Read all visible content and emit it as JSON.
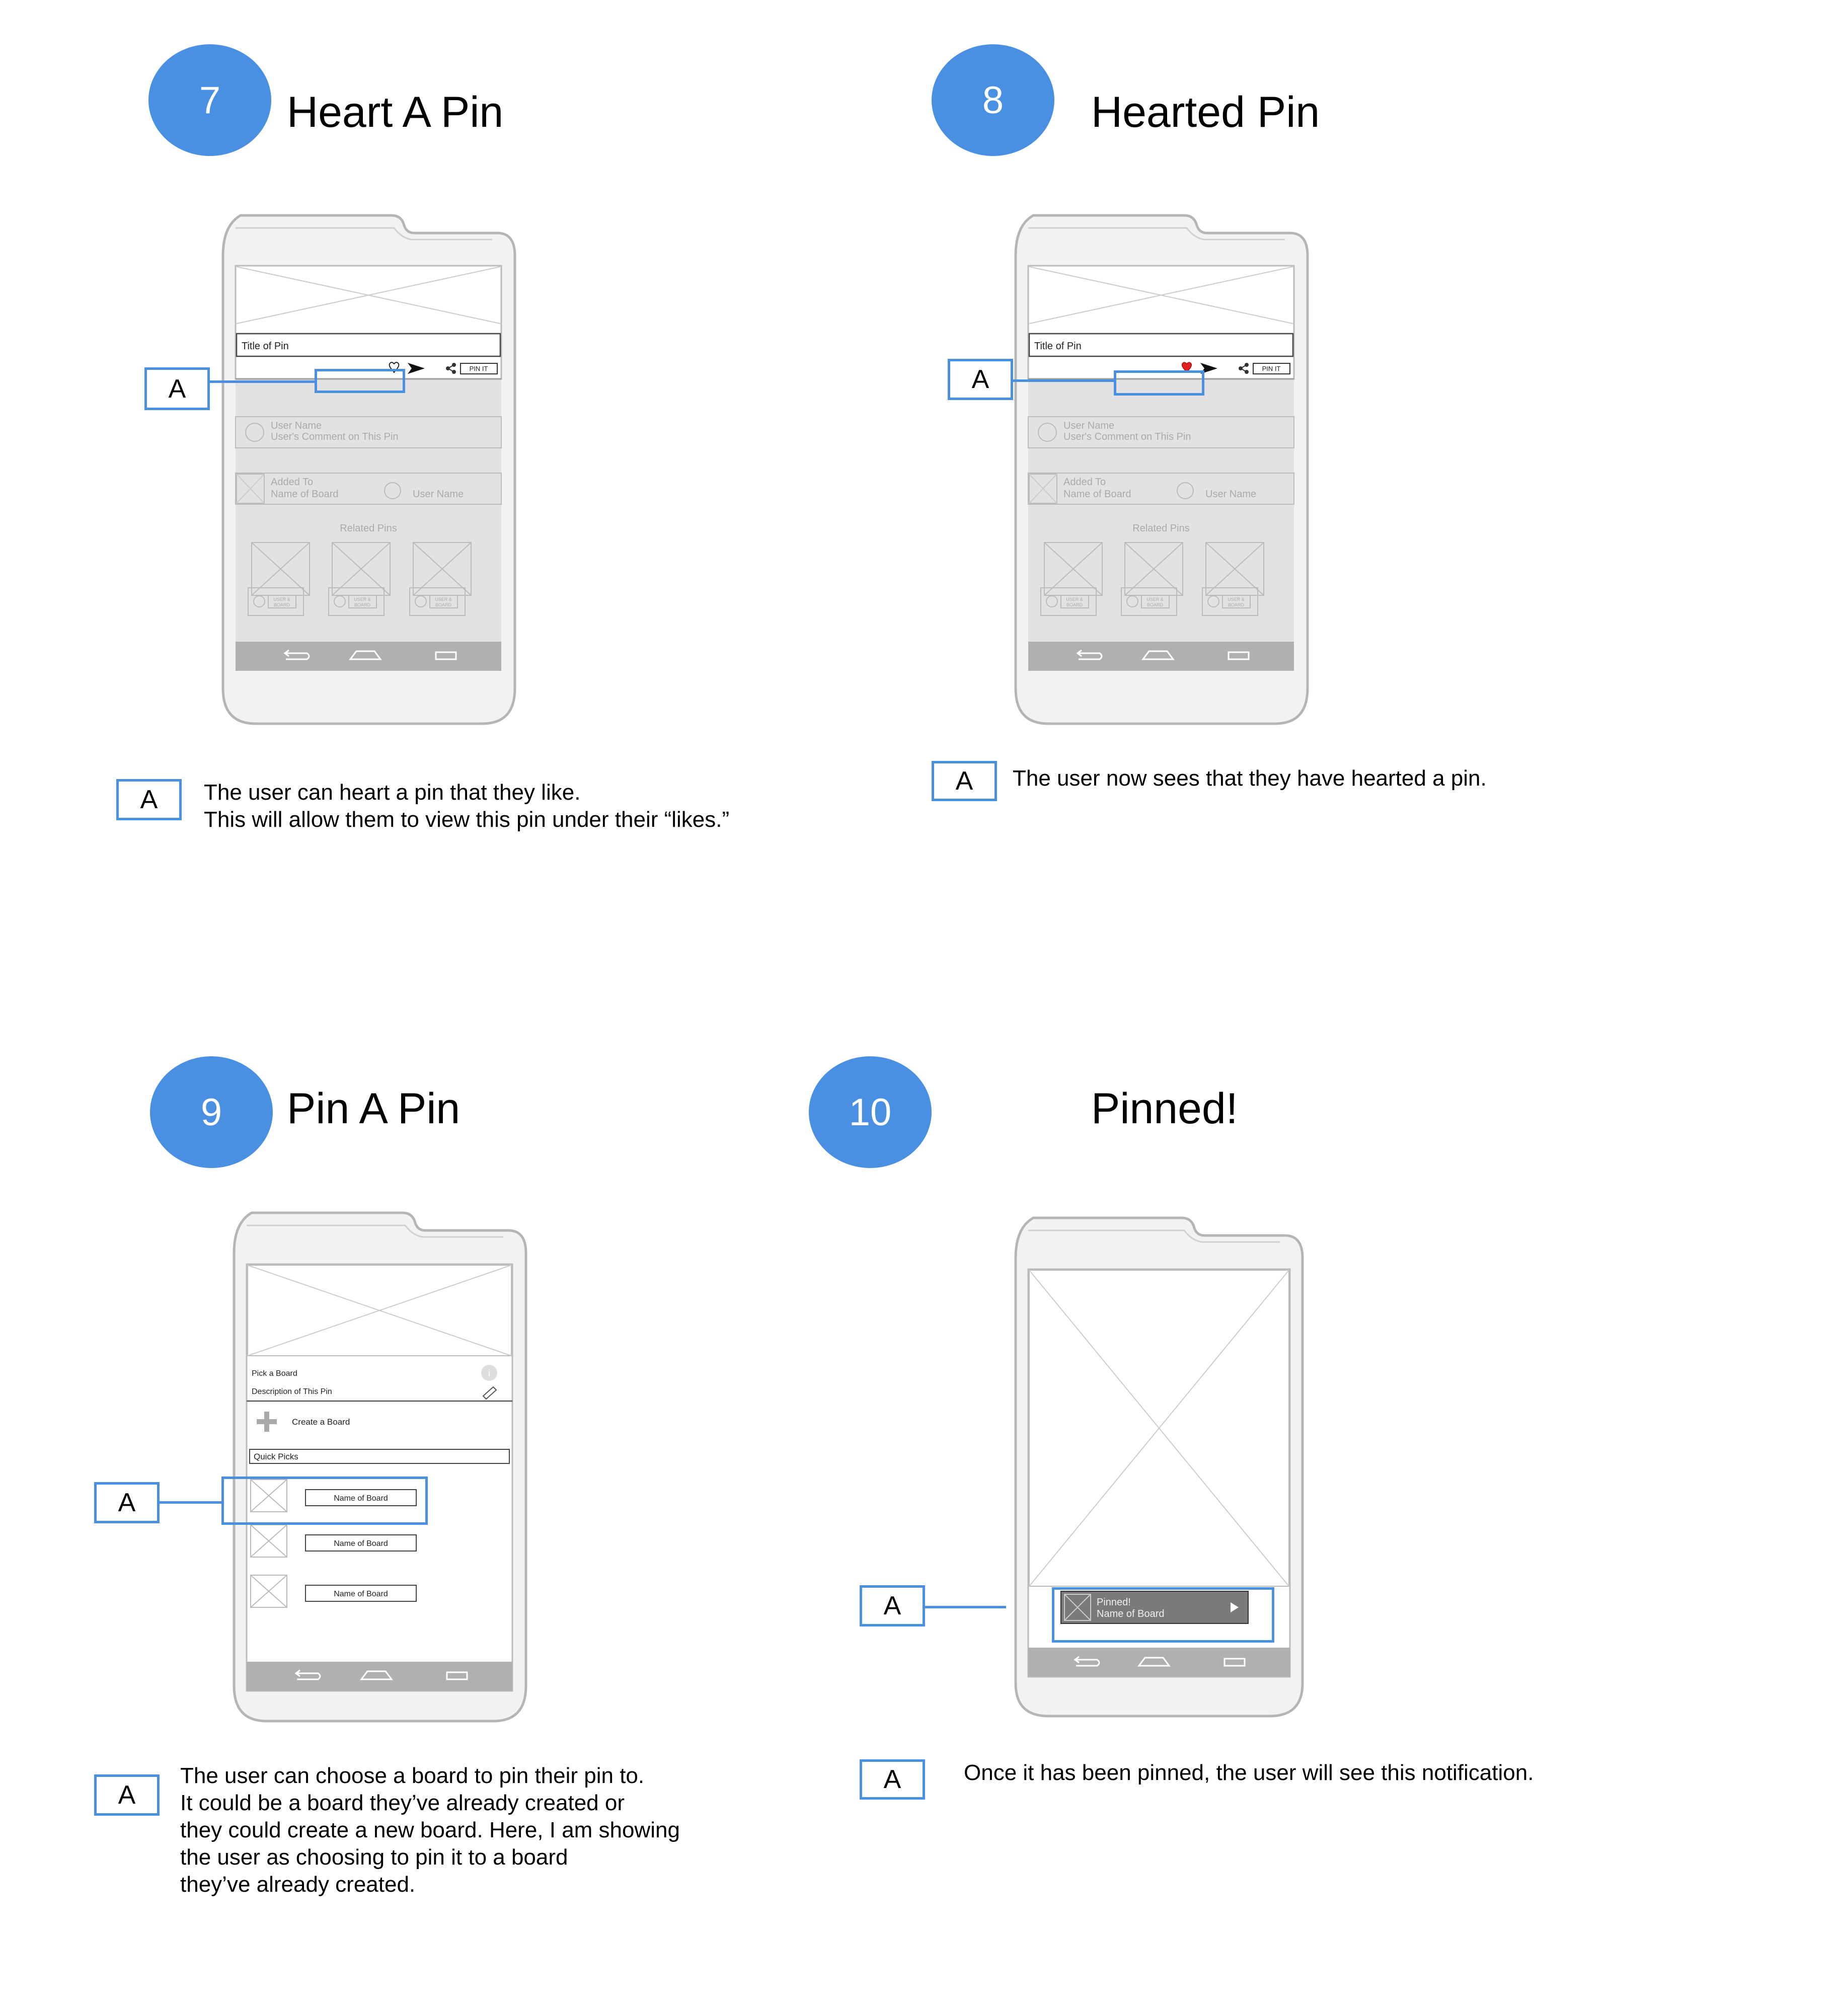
{
  "sections": [
    {
      "number": "7",
      "title": "Heart A Pin",
      "callout": "A",
      "description": [
        "The user can heart a pin that they like.",
        "This will allow them to view this pin under their “likes.”"
      ],
      "phone": {
        "pin_title": "Title of Pin",
        "pin_it": "PIN IT",
        "user_name": "User Name",
        "user_comment": "User's Comment on This Pin",
        "added_to": "Added To",
        "name_of_board": "Name of Board",
        "related_pins": "Related Pins",
        "user_board_top": "USER &",
        "user_board_bottom": "BOARD",
        "hearted": false
      }
    },
    {
      "number": "8",
      "title": "Hearted Pin",
      "callout": "A",
      "description": [
        "The user now sees that they have hearted a pin."
      ],
      "phone": {
        "pin_title": "Title of Pin",
        "pin_it": "PIN IT",
        "user_name": "User Name",
        "user_comment": "User's Comment on This Pin",
        "added_to": "Added To",
        "name_of_board": "Name of Board",
        "related_pins": "Related Pins",
        "user_board_top": "USER &",
        "user_board_bottom": "BOARD",
        "hearted": true
      }
    },
    {
      "number": "9",
      "title": "Pin A Pin",
      "callout": "A",
      "description": [
        "The user can choose a board to pin their pin to.",
        "It could be a board they’ve already created or",
        "they could create a new board. Here, I am showing",
        "the user as choosing to pin it to a board",
        "they’ve already created."
      ],
      "phone": {
        "pick_board": "Pick a Board",
        "description_of_pin": "Description of This Pin",
        "create_board": "Create a Board",
        "quick_picks": "Quick Picks",
        "boards": [
          "Name of Board",
          "Name of Board",
          "Name of Board"
        ]
      }
    },
    {
      "number": "10",
      "title": "Pinned!",
      "callout": "A",
      "description": [
        "Once it has been pinned, the user will see this notification."
      ],
      "phone": {
        "toast_title": "Pinned!",
        "toast_board": "Name of Board"
      }
    }
  ],
  "colors": {
    "accent": "#4a90e2",
    "heart_filled": "#e02020",
    "nav_bar": "#b0b0b0",
    "toast": "#7a7a7a"
  }
}
